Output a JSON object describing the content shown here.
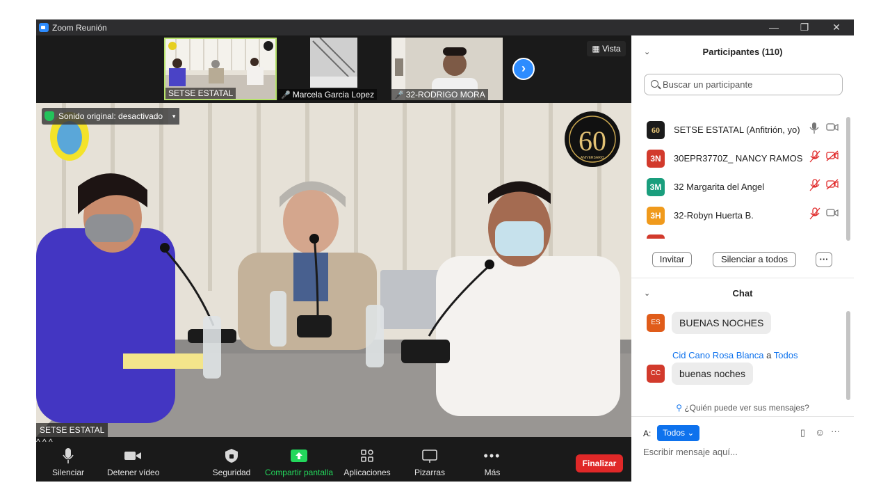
{
  "window": {
    "title": "Zoom Reunión",
    "controls": [
      "—",
      "❐",
      "✕"
    ]
  },
  "strip": {
    "thumbnails": [
      {
        "name": "SETSE ESTATAL",
        "muted": false
      },
      {
        "name": "Marcela Garcia Lopez",
        "muted": true
      },
      {
        "name": "32-RODRIGO MORA",
        "muted": true
      }
    ],
    "view_label": "Vista"
  },
  "main_video": {
    "sound_status": "Sonido original: desactivado",
    "speaker_name": "SETSE ESTATAL",
    "badge_text": "60",
    "badge_subtext": "ANIVERSARIO"
  },
  "toolbar": {
    "mute": "Silenciar",
    "stop_video": "Detener vídeo",
    "security": "Seguridad",
    "share": "Compartir pantalla",
    "apps": "Aplicaciones",
    "whiteboards": "Pizarras",
    "more": "Más",
    "end": "Finalizar",
    "accent": "#23d85c",
    "end_color": "#e02828"
  },
  "participants": {
    "title": "Participantes (110)",
    "search_placeholder": "Buscar un participante",
    "list": [
      {
        "initials": "60",
        "name": "SETSE ESTATAL (Anfitrión, yo)",
        "color": "#1b1b1b",
        "mic_muted": false,
        "video_off": false
      },
      {
        "initials": "3N",
        "name": "30EPR3770Z_ NANCY RAMOS",
        "color": "#d23a2c",
        "mic_muted": true,
        "video_off": true
      },
      {
        "initials": "3M",
        "name": "32 Margarita del Angel",
        "color": "#1a9e7d",
        "mic_muted": true,
        "video_off": true
      },
      {
        "initials": "3H",
        "name": "32-Robyn Huerta B.",
        "color": "#f09a1c",
        "mic_muted": true,
        "video_off": false
      }
    ],
    "invite": "Invitar",
    "mute_all": "Silenciar a todos",
    "more": "···"
  },
  "chat": {
    "title": "Chat",
    "messages": [
      {
        "initials": "ES",
        "color": "#e05c1a",
        "text": "BUENAS NOCHES"
      },
      {
        "initials": "CC",
        "color": "#d23a2c",
        "sender": "Cid Cano Rosa Blanca",
        "connector": "a",
        "recipient": "Todos",
        "text": "buenas noches"
      }
    ],
    "who_can_see": "¿Quién puede ver sus mensajes?",
    "to_label": "A:",
    "to_value": "Todos",
    "input_placeholder": "Escribir mensaje aquí..."
  }
}
